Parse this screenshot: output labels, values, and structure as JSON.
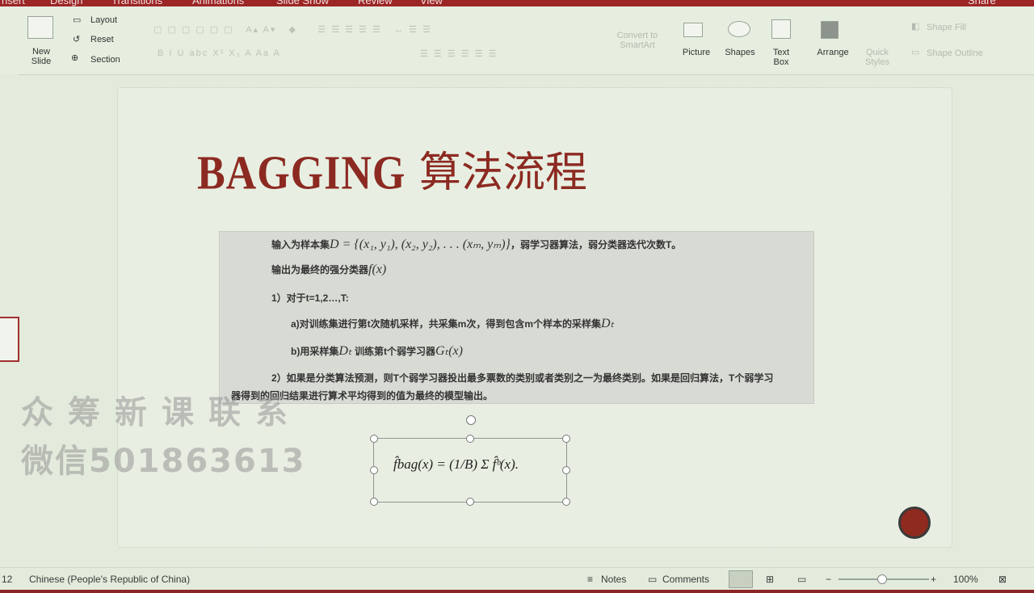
{
  "menu": {
    "items": [
      "nsert",
      "Design",
      "Transitions",
      "Animations",
      "Slide Show",
      "Review",
      "View"
    ],
    "share": "Share"
  },
  "ribbon": {
    "new_slide": "New\nSlide",
    "layout": "Layout",
    "reset": "Reset",
    "section": "Section",
    "convert_smartart": "Convert to\nSmartArt",
    "picture": "Picture",
    "shapes": "Shapes",
    "text_box": "Text\nBox",
    "arrange": "Arrange",
    "quick_styles": "Quick\nStyles",
    "shape_fill": "Shape Fill",
    "shape_outline": "Shape Outline",
    "format_row": "B  I  U  abc  X²  X₂  A  Aa  A"
  },
  "slide": {
    "title_latin": "BAGGING",
    "title_cjk": "算法流程",
    "lines": {
      "l1_prefix": "输入为样本集",
      "l1_math": "D = {(x₁, y₁), (x₂, y₂), . . . (xₘ, yₘ)}",
      "l1_suffix": "，弱学习器算法，弱分类器迭代次数T。",
      "l2_prefix": "输出为最终的强分类器",
      "l2_math": "f(x)",
      "l3": "1）对于t=1,2…,T:",
      "l4_prefix": "a)对训练集进行第t次随机采样，共采集m次，得到包含m个样本的采样集",
      "l4_math": "Dₜ",
      "l5_prefix": "b)用采样集",
      "l5_math1": "Dₜ",
      "l5_mid": "训练第t个弱学习器",
      "l5_math2": "Gₜ(x)",
      "l6": "2）如果是分类算法预测，则T个弱学习器投出最多票数的类别或者类别之一为最终类别。如果是回归算法，T个弱学习",
      "l7": "器得到的回归结果进行算术平均得到的值为最终的模型输出。"
    },
    "formula": "f̂bag(x) = (1/B) Σ f̂ᵇ(x)."
  },
  "watermark": {
    "line1": "众筹新课联系",
    "line2": "微信501863613"
  },
  "status": {
    "slide_num": "12",
    "language": "Chinese (People's Republic of China)",
    "notes": "Notes",
    "comments": "Comments",
    "zoom": "100%"
  },
  "colors": {
    "accent": "#9c2626",
    "title": "#8c2a22",
    "background": "#e3ebdc"
  }
}
